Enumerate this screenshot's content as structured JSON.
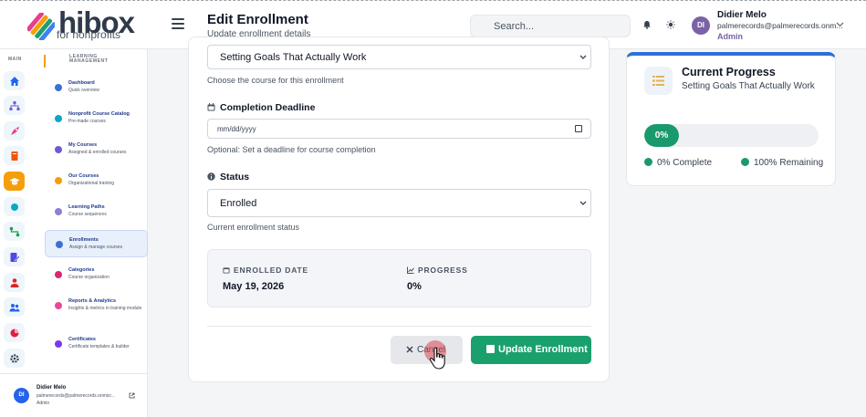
{
  "header": {
    "logo_word": "hibox",
    "logo_sub": "for nonprofits",
    "title": "Edit Enrollment",
    "subtitle": "Update enrollment details",
    "search_placeholder": "Search...",
    "user": {
      "initials": "DI",
      "name": "Didier Melo",
      "email": "palmerecords@palmerecords.onm...",
      "role": "Admin"
    }
  },
  "rail": {
    "label": "MAIN",
    "icons": [
      "home-icon",
      "sitemap-icon",
      "rocket-icon",
      "book-icon",
      "graduation-cap-icon",
      "circle-icon",
      "route-icon",
      "file-edit-icon",
      "user-tie-icon",
      "users-icon",
      "chart-pie-icon",
      "gear-icon"
    ]
  },
  "sidebar": {
    "section": "LEARNING MANAGEMENT",
    "items": [
      {
        "title": "Dashboard",
        "desc": "Quick overview",
        "color": "#3b6fd8"
      },
      {
        "title": "Nonprofit Course Catalog",
        "desc": "Pre-made courses",
        "color": "#0ea5c6"
      },
      {
        "title": "My Courses",
        "desc": "Assigned & enrolled courses",
        "color": "#6d5bd0"
      },
      {
        "title": "Our Courses",
        "desc": "Organizational training",
        "color": "#f59e0b"
      },
      {
        "title": "Learning Paths",
        "desc": "Course sequences",
        "color": "#8b7fd6"
      },
      {
        "title": "Enrollments",
        "desc": "Assign & manage courses",
        "color": "#3b6fd8"
      },
      {
        "title": "Categories",
        "desc": "Course organization",
        "color": "#db2777"
      },
      {
        "title": "Reports & Analytics",
        "desc": "Insights & metrics in training module",
        "color": "#ec4899"
      },
      {
        "title": "Certificates",
        "desc": "Certificate templates & builder",
        "color": "#7c3aed"
      }
    ],
    "footer": {
      "initials": "DI",
      "name": "Didier Melo",
      "email": "palmerecords@palmerecords.onmicr...",
      "role": "Admin"
    }
  },
  "form": {
    "course_value": "Setting Goals That Actually Work",
    "course_helper": "Choose the course for this enrollment",
    "deadline_label": "Completion Deadline",
    "deadline_placeholder": "mm/dd/yyyy",
    "deadline_helper": "Optional: Set a deadline for course completion",
    "status_label": "Status",
    "status_value": "Enrolled",
    "status_helper": "Current enrollment status",
    "enrolled_date_label": "ENROLLED DATE",
    "enrolled_date_value": "May 19, 2026",
    "progress_label": "PROGRESS",
    "progress_value": "0%",
    "cancel_label": "Cancel",
    "update_label": "Update Enrollment"
  },
  "progress_card": {
    "title": "Current Progress",
    "course": "Setting Goals That Actually Work",
    "percent_label": "0%",
    "complete_label": "0% Complete",
    "remaining_label": "100% Remaining",
    "accent": "#1a9a6c"
  }
}
